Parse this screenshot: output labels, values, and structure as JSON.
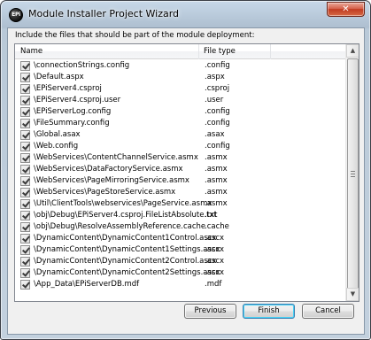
{
  "window": {
    "title": "Module Installer Project Wizard",
    "app_icon_text": "EPi",
    "close_glyph": "✕"
  },
  "instruction": "Include the files that should be part of the module deployment:",
  "table": {
    "columns": [
      "Name",
      "File type"
    ],
    "rows": [
      {
        "name": "\\connectionStrings.config",
        "type": ".config",
        "checked": true
      },
      {
        "name": "\\Default.aspx",
        "type": ".aspx",
        "checked": true
      },
      {
        "name": "\\EPiServer4.csproj",
        "type": ".csproj",
        "checked": true
      },
      {
        "name": "\\EPiServer4.csproj.user",
        "type": ".user",
        "checked": true
      },
      {
        "name": "\\EPiServerLog.config",
        "type": ".config",
        "checked": true
      },
      {
        "name": "\\FileSummary.config",
        "type": ".config",
        "checked": true
      },
      {
        "name": "\\Global.asax",
        "type": ".asax",
        "checked": true
      },
      {
        "name": "\\Web.config",
        "type": ".config",
        "checked": true
      },
      {
        "name": "\\WebServices\\ContentChannelService.asmx",
        "type": ".asmx",
        "checked": true
      },
      {
        "name": "\\WebServices\\DataFactoryService.asmx",
        "type": ".asmx",
        "checked": true
      },
      {
        "name": "\\WebServices\\PageMirroringService.asmx",
        "type": ".asmx",
        "checked": true
      },
      {
        "name": "\\WebServices\\PageStoreService.asmx",
        "type": ".asmx",
        "checked": true
      },
      {
        "name": "\\Util\\ClientTools\\webservices\\PageService.asmx",
        "type": ".asmx",
        "checked": true
      },
      {
        "name": "\\obj\\Debug\\EPiServer4.csproj.FileListAbsolute.txt",
        "type": ".txt",
        "checked": true
      },
      {
        "name": "\\obj\\Debug\\ResolveAssemblyReference.cache",
        "type": ".cache",
        "checked": true
      },
      {
        "name": "\\DynamicContent\\DynamicContent1Control.ascx",
        "type": ".ascx",
        "checked": true
      },
      {
        "name": "\\DynamicContent\\DynamicContent1Settings.ascx",
        "type": ".ascx",
        "checked": true
      },
      {
        "name": "\\DynamicContent\\DynamicContent2Control.ascx",
        "type": ".ascx",
        "checked": true
      },
      {
        "name": "\\DynamicContent\\DynamicContent2Settings.ascx",
        "type": ".ascx",
        "checked": true
      },
      {
        "name": "\\App_Data\\EPiServerDB.mdf",
        "type": ".mdf",
        "checked": true
      }
    ]
  },
  "scrollbar": {
    "up_glyph": "▲",
    "down_glyph": "▼"
  },
  "buttons": {
    "previous": "Previous",
    "finish": "Finish",
    "cancel": "Cancel"
  }
}
